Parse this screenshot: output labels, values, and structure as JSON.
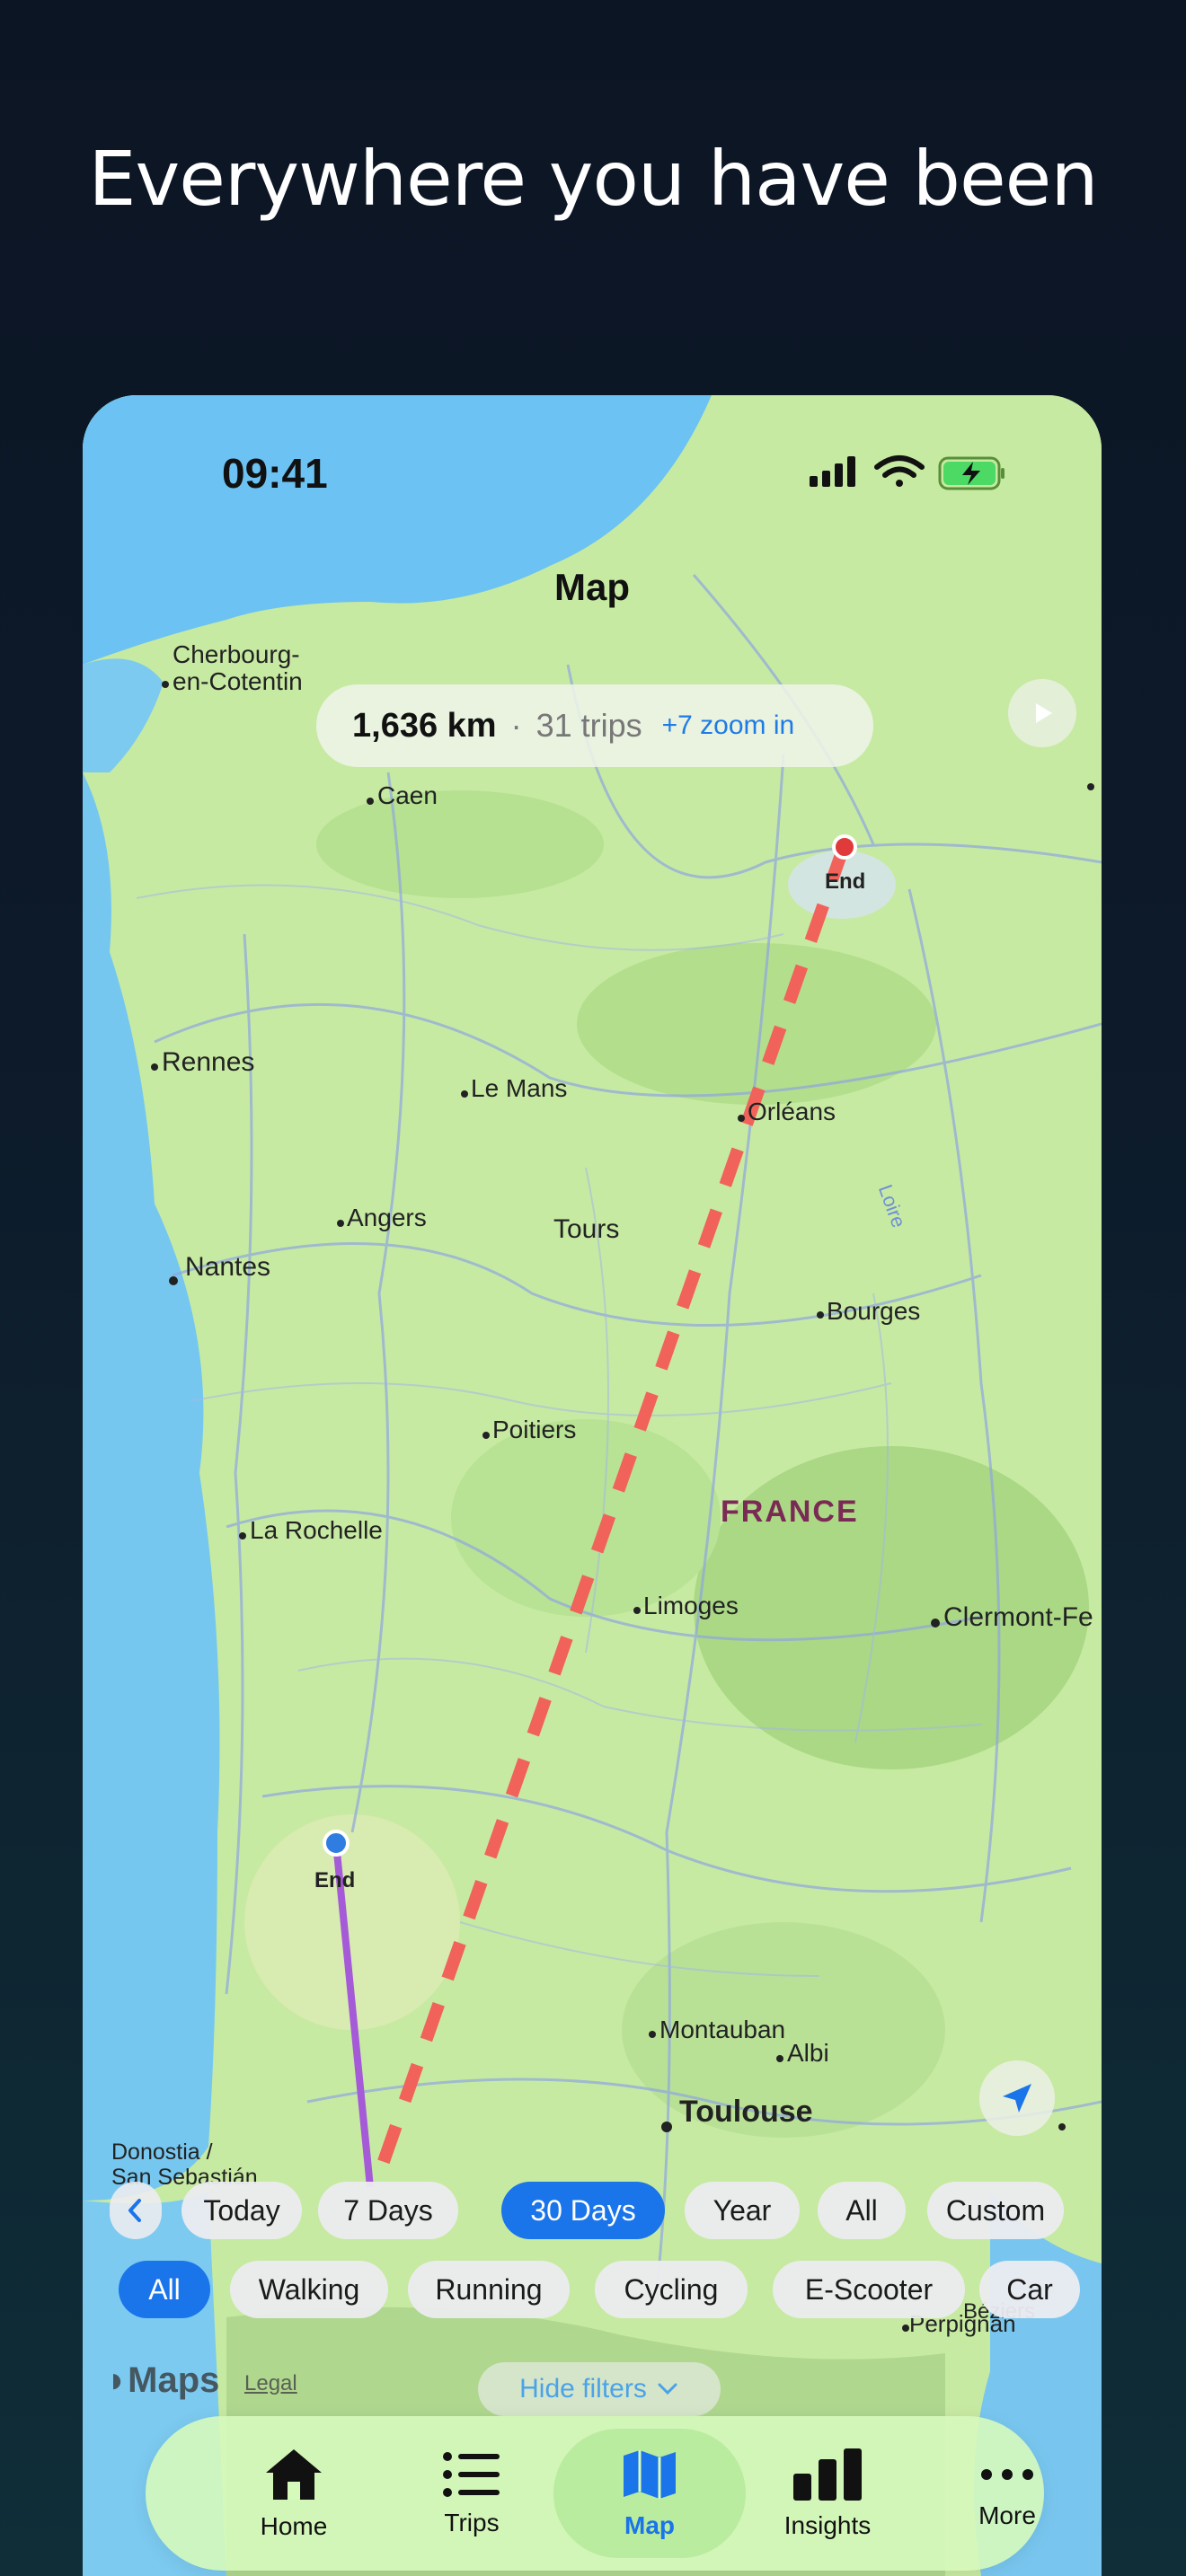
{
  "headline": "Everywhere you have been",
  "status_bar": {
    "time": "09:41"
  },
  "nav": {
    "title": "Map"
  },
  "stats": {
    "distance": "1,636 km",
    "separator": "·",
    "trips": "31 trips",
    "zoom_hint": "+7 zoom in"
  },
  "time_filters": [
    {
      "label": "Today",
      "active": false
    },
    {
      "label": "7 Days",
      "active": false
    },
    {
      "label": "30 Days",
      "active": true
    },
    {
      "label": "Year",
      "active": false
    },
    {
      "label": "All",
      "active": false
    },
    {
      "label": "Custom",
      "active": false
    }
  ],
  "mode_filters": [
    {
      "label": "All",
      "active": true
    },
    {
      "label": "Walking",
      "active": false
    },
    {
      "label": "Running",
      "active": false
    },
    {
      "label": "Cycling",
      "active": false
    },
    {
      "label": "E-Scooter",
      "active": false
    },
    {
      "label": "Car",
      "active": false
    }
  ],
  "hide_filters": "Hide filters",
  "map_attribution": {
    "brand": "Maps",
    "legal": "Legal"
  },
  "map_labels": {
    "cherbourg": "Cherbourg-\nen-Cotentin",
    "caen": "Caen",
    "rennes": "Rennes",
    "le_mans": "Le Mans",
    "orleans": "Orléans",
    "angers": "Angers",
    "tours": "Tours",
    "nantes": "Nantes",
    "bourges": "Bourges",
    "poitiers": "Poitiers",
    "france": "FRANCE",
    "la_rochelle": "La Rochelle",
    "limoges": "Limoges",
    "clermont": "Clermont-Fe",
    "montauban": "Montauban",
    "albi": "Albi",
    "toulouse": "Toulouse",
    "donostia": "Donostia /\nSan Sebastián",
    "beziers": "Béziers",
    "perpignan": "Perpignan",
    "loire": "Loire",
    "end_north": "End",
    "end_south": "End"
  },
  "tabs": [
    {
      "label": "Home",
      "icon": "house-icon",
      "active": false
    },
    {
      "label": "Trips",
      "icon": "list-icon",
      "active": false
    },
    {
      "label": "Map",
      "icon": "map-icon",
      "active": true
    },
    {
      "label": "Insights",
      "icon": "bar-chart-icon",
      "active": false
    },
    {
      "label": "More",
      "icon": "ellipsis-icon",
      "active": false
    }
  ],
  "colors": {
    "accent": "#1a74ea",
    "route_dashed": "#f0625a",
    "route_walk": "#a55ad8",
    "end_north": "#e03a3a",
    "end_south": "#2f7de0"
  }
}
